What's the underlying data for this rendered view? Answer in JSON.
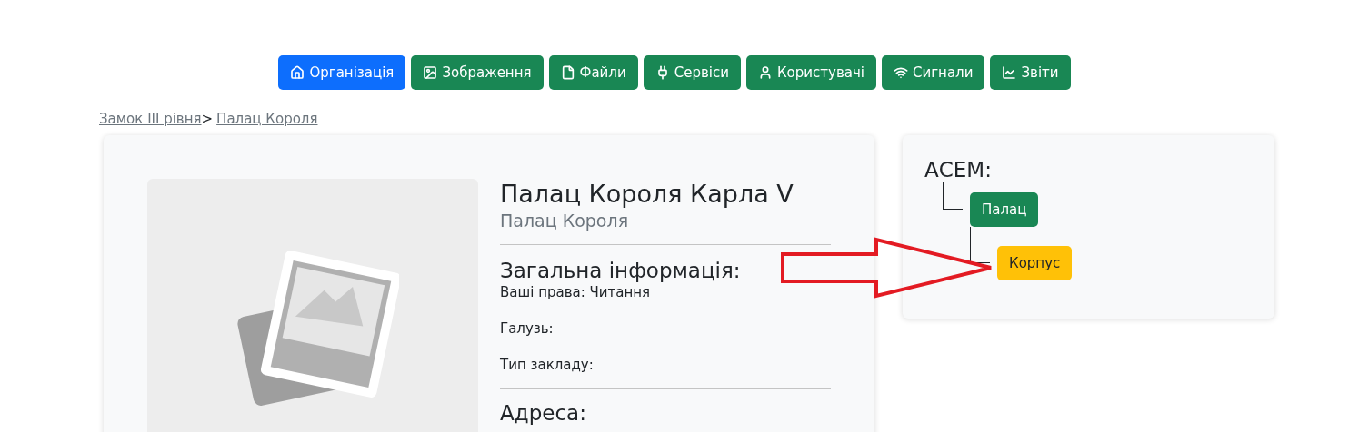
{
  "nav": [
    {
      "label": "Організація",
      "selected": true
    },
    {
      "label": "Зображення",
      "selected": false
    },
    {
      "label": "Файли",
      "selected": false
    },
    {
      "label": "Сервіси",
      "selected": false
    },
    {
      "label": "Користувачі",
      "selected": false
    },
    {
      "label": "Сигнали",
      "selected": false
    },
    {
      "label": "Звіти",
      "selected": false
    }
  ],
  "breadcrumb": [
    {
      "label": "Замок III рівня"
    },
    {
      "label": "Палац Короля"
    }
  ],
  "breadcrumb_separator": ">",
  "organization": {
    "title": "Палац Короля Карла V",
    "subtitle": "Палац Короля",
    "section_title": "Загальна інформація:",
    "fields": [
      "Ваші права: Читання",
      "Галузь:",
      "Тип закладу:"
    ],
    "next_section_title": "Адреса:"
  },
  "tree": {
    "title": "АСЕМ:",
    "nodes": [
      {
        "label": "Палац",
        "color": "#198754",
        "children": [
          {
            "label": "Корпус",
            "color": "#ffc107"
          }
        ]
      }
    ]
  }
}
